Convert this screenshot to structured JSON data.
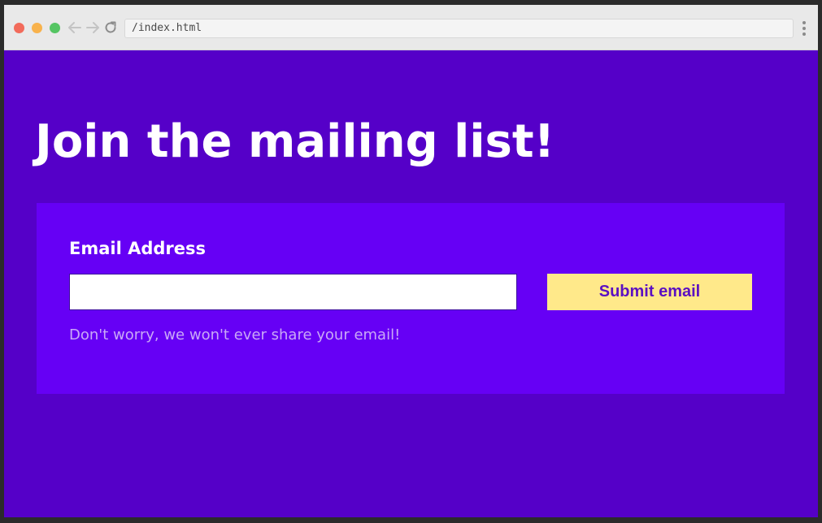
{
  "browser": {
    "url": "/index.html"
  },
  "page": {
    "heading": "Join the mailing list!",
    "form": {
      "label": "Email Address",
      "email_value": "",
      "submit_label": "Submit email",
      "hint": "Don't worry, we won't ever share your email!"
    }
  },
  "colors": {
    "page_background": "#5500c8",
    "card_background": "#6600f5",
    "button_background": "#ffe98a",
    "button_text": "#5b10c2",
    "hint_text": "#c9a9f7"
  },
  "icons": {
    "back": "arrow-left-icon",
    "forward": "arrow-right-icon",
    "reload": "reload-icon",
    "menu": "kebab-menu-icon"
  }
}
